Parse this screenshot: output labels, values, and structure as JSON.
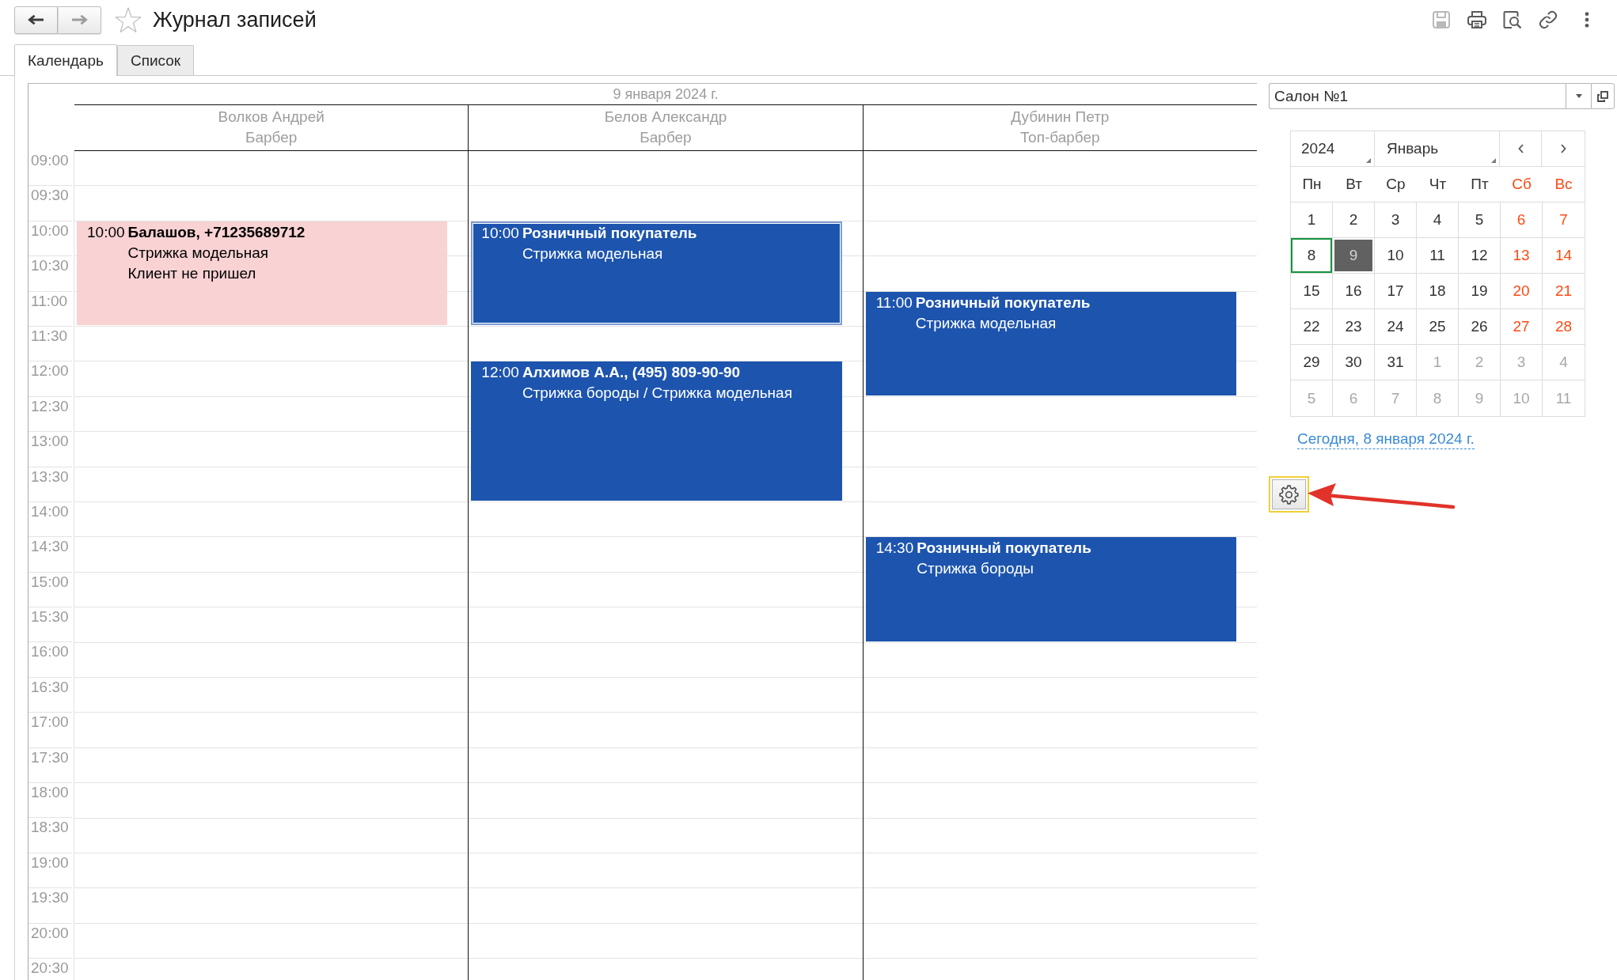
{
  "window": {
    "title": "Журнал записей",
    "favorite": false
  },
  "navigation": [
    {
      "kind": "back",
      "disabled": false
    },
    {
      "kind": "forward",
      "disabled": true
    }
  ],
  "toolbar": [
    {
      "kind": "save",
      "disabled": true
    },
    {
      "kind": "print",
      "disabled": false
    },
    {
      "kind": "preview",
      "disabled": false
    },
    {
      "kind": "link",
      "disabled": false
    },
    {
      "kind": "more",
      "disabled": false
    }
  ],
  "tabs": [
    {
      "label": "Календарь",
      "selected": true
    },
    {
      "label": "Список",
      "selected": false
    }
  ],
  "schedule": {
    "date": "9 января 2024 г.",
    "times": [
      "09:00",
      "09:30",
      "10:00",
      "10:30",
      "11:00",
      "11:30",
      "12:00",
      "12:30",
      "13:00",
      "13:30",
      "14:00",
      "14:30",
      "15:00",
      "15:30",
      "16:00",
      "16:30",
      "17:00",
      "17:30",
      "18:00",
      "18:30",
      "19:00",
      "19:30",
      "20:00",
      "20:30"
    ],
    "columns": [
      {
        "name": "Волков Андрей",
        "role": "Барбер",
        "appointments": [
          {
            "kind": "short",
            "time": "10:00",
            "title": "Балашов, +71235689712",
            "lines": [
              "Стрижка модельная",
              "Клиент не пришел"
            ],
            "color": "#f9d3d3",
            "selected": false
          }
        ]
      },
      {
        "name": "Белов Александр",
        "role": "Барбер",
        "appointments": [
          {
            "kind": "short",
            "time": "10:00",
            "title": "Розничный покупатель",
            "lines": [
              "Стрижка модельная"
            ],
            "color": "#1d55ae",
            "selected": true
          },
          {
            "kind": "long",
            "time": "12:00",
            "title": "Алхимов А.А., (495) 809-90-90",
            "lines": [
              "Стрижка бороды / Стрижка модельная"
            ],
            "color": "#1d55ae",
            "selected": false
          }
        ]
      },
      {
        "name": "Дубинин Петр",
        "role": "Топ-барбер",
        "appointments": [
          {
            "kind": "short",
            "time": "11:00",
            "title": "Розничный покупатель",
            "lines": [
              "Стрижка модельная"
            ],
            "color": "#1d55ae",
            "selected": false
          },
          {
            "kind": "short",
            "time": "14:30",
            "title": "Розничный покупатель",
            "lines": [
              "Стрижка бороды"
            ],
            "color": "#1d55ae",
            "selected": false
          }
        ]
      }
    ]
  },
  "salon_field": {
    "value": "Салон №1"
  },
  "mini_calendar": {
    "year": "2024",
    "month": "Январь",
    "weekdays": [
      {
        "label": "Пн",
        "weekend": false
      },
      {
        "label": "Вт",
        "weekend": false
      },
      {
        "label": "Ср",
        "weekend": false
      },
      {
        "label": "Чт",
        "weekend": false
      },
      {
        "label": "Пт",
        "weekend": false
      },
      {
        "label": "Сб",
        "weekend": true
      },
      {
        "label": "Вс",
        "weekend": true
      }
    ],
    "days": [
      {
        "day": "1",
        "kind": "weekday",
        "today": false,
        "selected": false
      },
      {
        "day": "2",
        "kind": "weekday",
        "today": false,
        "selected": false
      },
      {
        "day": "3",
        "kind": "weekday",
        "today": false,
        "selected": false
      },
      {
        "day": "4",
        "kind": "weekday",
        "today": false,
        "selected": false
      },
      {
        "day": "5",
        "kind": "weekday",
        "today": false,
        "selected": false
      },
      {
        "day": "6",
        "kind": "weekend",
        "today": false,
        "selected": false
      },
      {
        "day": "7",
        "kind": "weekend",
        "today": false,
        "selected": false
      },
      {
        "day": "8",
        "kind": "weekday",
        "today": true,
        "selected": false
      },
      {
        "day": "9",
        "kind": "weekday",
        "today": false,
        "selected": true
      },
      {
        "day": "10",
        "kind": "weekday",
        "today": false,
        "selected": false
      },
      {
        "day": "11",
        "kind": "weekday",
        "today": false,
        "selected": false
      },
      {
        "day": "12",
        "kind": "weekday",
        "today": false,
        "selected": false
      },
      {
        "day": "13",
        "kind": "weekend",
        "today": false,
        "selected": false
      },
      {
        "day": "14",
        "kind": "weekend",
        "today": false,
        "selected": false
      },
      {
        "day": "15",
        "kind": "weekday",
        "today": false,
        "selected": false
      },
      {
        "day": "16",
        "kind": "weekday",
        "today": false,
        "selected": false
      },
      {
        "day": "17",
        "kind": "weekday",
        "today": false,
        "selected": false
      },
      {
        "day": "18",
        "kind": "weekday",
        "today": false,
        "selected": false
      },
      {
        "day": "19",
        "kind": "weekday",
        "today": false,
        "selected": false
      },
      {
        "day": "20",
        "kind": "weekend",
        "today": false,
        "selected": false
      },
      {
        "day": "21",
        "kind": "weekend",
        "today": false,
        "selected": false
      },
      {
        "day": "22",
        "kind": "weekday",
        "today": false,
        "selected": false
      },
      {
        "day": "23",
        "kind": "weekday",
        "today": false,
        "selected": false
      },
      {
        "day": "24",
        "kind": "weekday",
        "today": false,
        "selected": false
      },
      {
        "day": "25",
        "kind": "weekday",
        "today": false,
        "selected": false
      },
      {
        "day": "26",
        "kind": "weekday",
        "today": false,
        "selected": false
      },
      {
        "day": "27",
        "kind": "weekend",
        "today": false,
        "selected": false
      },
      {
        "day": "28",
        "kind": "weekend",
        "today": false,
        "selected": false
      },
      {
        "day": "29",
        "kind": "weekday",
        "today": false,
        "selected": false
      },
      {
        "day": "30",
        "kind": "weekday",
        "today": false,
        "selected": false
      },
      {
        "day": "31",
        "kind": "weekday",
        "today": false,
        "selected": false
      },
      {
        "day": "1",
        "kind": "other_month",
        "today": false,
        "selected": false
      },
      {
        "day": "2",
        "kind": "other_month",
        "today": false,
        "selected": false
      },
      {
        "day": "3",
        "kind": "other_month",
        "today": false,
        "selected": false
      },
      {
        "day": "4",
        "kind": "other_month",
        "today": false,
        "selected": false
      },
      {
        "day": "5",
        "kind": "other_month",
        "today": false,
        "selected": false
      },
      {
        "day": "6",
        "kind": "other_month",
        "today": false,
        "selected": false
      },
      {
        "day": "7",
        "kind": "other_month",
        "today": false,
        "selected": false
      },
      {
        "day": "8",
        "kind": "other_month",
        "today": false,
        "selected": false
      },
      {
        "day": "9",
        "kind": "other_month",
        "today": false,
        "selected": false
      },
      {
        "day": "10",
        "kind": "other_month",
        "today": false,
        "selected": false
      },
      {
        "day": "11",
        "kind": "other_month",
        "today": false,
        "selected": false
      }
    ]
  },
  "today_link": "Сегодня, 8 января 2024 г.",
  "settings_button": {
    "focused": true
  }
}
